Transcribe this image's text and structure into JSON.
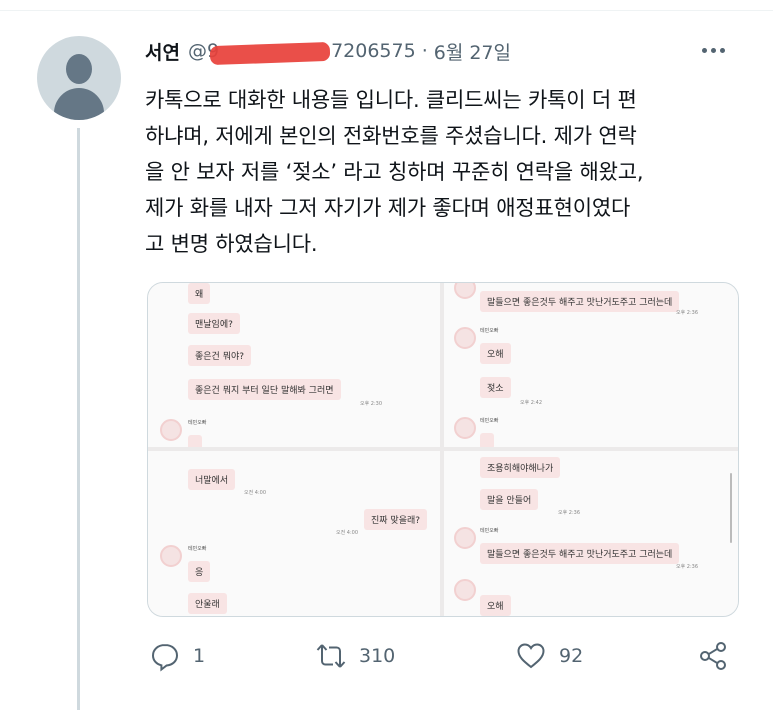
{
  "tweet": {
    "author_name": "서연",
    "handle": "@9",
    "handle_tail": "7206575",
    "separator": "·",
    "date": "6월 27일",
    "text_lines": [
      "카톡으로 대화한 내용들 입니다. 클리드씨는 카톡이 더 편",
      "하냐며, 저에게 본인의 전화번호를 주셨습니다. 제가 연락",
      "을 안 보자 저를 ‘젖소’ 라고 칭하며 꾸준히 연락을 해왔고,",
      "제가 화를 내자 그저 자기가 제가 좋다며 애정표현이였다",
      "고 변명 하였습니다."
    ]
  },
  "media": {
    "panel1": {
      "m1": "왜",
      "m2": "맨날임에?",
      "m3": "좋은건 뭐야?",
      "m4": "좋은건 뭐지 부터 일단 말해봐 그러면",
      "t4": "오후 2:30",
      "sender": "테민오빠"
    },
    "panel2": {
      "m1": "말들으면 좋은것두 해주고 맛난거도주고 그러는데",
      "t1": "오후 2:36",
      "sender": "테민오빠",
      "m2": "오해",
      "m3": "젖소",
      "t3": "오후 2:42",
      "sender2": "테민오빠"
    },
    "panel3": {
      "m1": "너말에서",
      "t1": "오전 4:00",
      "m2": "진짜 맞을래?",
      "t2": "오전 4:00",
      "sender": "테민오빠",
      "m3": "응",
      "m4": "안울래"
    },
    "panel4": {
      "m1": "조용히해야해나가",
      "m2": "말을 안들어",
      "t2": "오후 2:36",
      "sender": "테민오빠",
      "m3": "말들으면 좋은것두 해주고 맛난거도주고 그러는데",
      "t3": "오후 2:36",
      "m4": "오해"
    }
  },
  "actions": {
    "reply_count": "1",
    "retweet_count": "310",
    "like_count": "92"
  },
  "icons": [
    "avatar-icon",
    "more-icon",
    "reply-icon",
    "retweet-icon",
    "like-icon",
    "share-icon"
  ],
  "colors": {
    "text": "#0f1419",
    "secondary": "#536471",
    "redaction": "#e8403a",
    "bubble": "#f8e4e4"
  }
}
